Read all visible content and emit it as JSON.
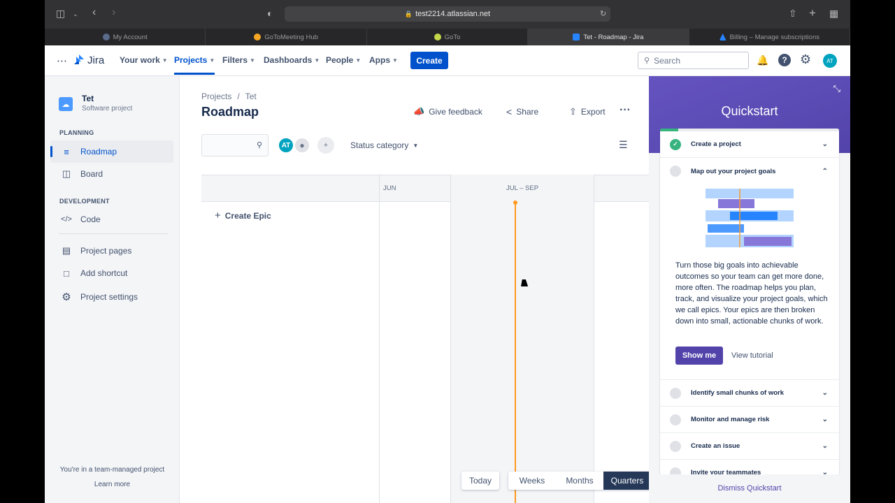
{
  "browser": {
    "url": "test2214.atlassian.net",
    "tabs": [
      {
        "label": "My Account",
        "color": "#5a6b8c"
      },
      {
        "label": "GoToMeeting Hub",
        "color": "#f5a623"
      },
      {
        "label": "GoTo",
        "color": "#c4d64a"
      },
      {
        "label": "Tet - Roadmap - Jira",
        "color": "#2684ff"
      },
      {
        "label": "Billing – Manage subscriptions",
        "color": "#2684ff"
      }
    ]
  },
  "topnav": {
    "logo": "Jira",
    "items": [
      "Your work",
      "Projects",
      "Filters",
      "Dashboards",
      "People",
      "Apps"
    ],
    "create": "Create",
    "search_placeholder": "Search",
    "avatar": "AT"
  },
  "sidebar": {
    "project_name": "Tet",
    "project_type": "Software project",
    "planning_label": "PLANNING",
    "roadmap": "Roadmap",
    "board": "Board",
    "development_label": "DEVELOPMENT",
    "code": "Code",
    "project_pages": "Project pages",
    "add_shortcut": "Add shortcut",
    "project_settings": "Project settings",
    "footer_text": "You're in a team-managed project",
    "learn_more": "Learn more"
  },
  "main": {
    "breadcrumb_projects": "Projects",
    "breadcrumb_sep": "/",
    "breadcrumb_project": "Tet",
    "title": "Roadmap",
    "give_feedback": "Give feedback",
    "share": "Share",
    "export": "Export",
    "avatar": "AT",
    "status_category": "Status category",
    "col_jun": "JUN",
    "col_jul_sep": "JUL – SEP",
    "create_epic": "Create Epic",
    "today": "Today",
    "weeks": "Weeks",
    "months": "Months",
    "quarters": "Quarters"
  },
  "quickstart": {
    "title": "Quickstart",
    "progress": 0.1,
    "items": [
      {
        "label": "Create a project",
        "done": true
      },
      {
        "label": "Map out your project goals",
        "done": false
      },
      {
        "label": "Identify small chunks of work",
        "done": false
      },
      {
        "label": "Monitor and manage risk",
        "done": false
      },
      {
        "label": "Create an issue",
        "done": false
      },
      {
        "label": "Invite your teammates",
        "done": false
      }
    ],
    "description": "Turn those big goals into achievable outcomes so your team can get more done, more often. The roadmap helps you plan, track, and visualize your project goals, which we call epics. Your epics are then broken down into small, actionable chunks of work.",
    "show_me": "Show me",
    "view_tutorial": "View tutorial",
    "dismiss": "Dismiss Quickstart"
  },
  "colors": {
    "brand": "#0052cc",
    "quickstart": "#5243aa",
    "today_line": "#ff991f"
  }
}
